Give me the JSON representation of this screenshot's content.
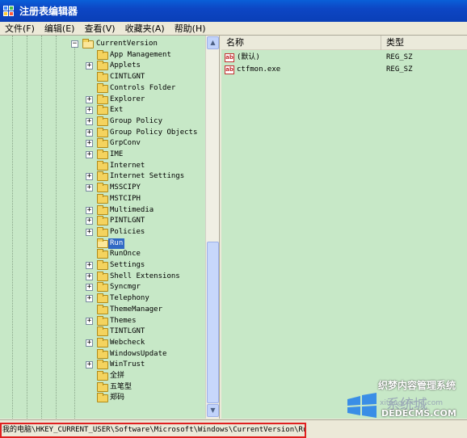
{
  "window": {
    "title": "注册表编辑器"
  },
  "menu": [
    {
      "label": "文件(F)"
    },
    {
      "label": "编辑(E)"
    },
    {
      "label": "查看(V)"
    },
    {
      "label": "收藏夹(A)"
    },
    {
      "label": "帮助(H)"
    }
  ],
  "tree": {
    "parent": {
      "label": "CurrentVersion",
      "expander": "−"
    },
    "items": [
      {
        "label": "App Management",
        "expandable": false
      },
      {
        "label": "Applets",
        "expandable": true
      },
      {
        "label": "CINTLGNT",
        "expandable": false
      },
      {
        "label": "Controls Folder",
        "expandable": false
      },
      {
        "label": "Explorer",
        "expandable": true
      },
      {
        "label": "Ext",
        "expandable": true
      },
      {
        "label": "Group Policy",
        "expandable": true
      },
      {
        "label": "Group Policy Objects",
        "expandable": true
      },
      {
        "label": "GrpConv",
        "expandable": true
      },
      {
        "label": "IME",
        "expandable": true
      },
      {
        "label": "Internet",
        "expandable": false
      },
      {
        "label": "Internet Settings",
        "expandable": true
      },
      {
        "label": "MSSCIPY",
        "expandable": true
      },
      {
        "label": "MSTCIPH",
        "expandable": false
      },
      {
        "label": "Multimedia",
        "expandable": true
      },
      {
        "label": "PINTLGNT",
        "expandable": true
      },
      {
        "label": "Policies",
        "expandable": true
      },
      {
        "label": "Run",
        "expandable": false,
        "selected": true
      },
      {
        "label": "RunOnce",
        "expandable": false
      },
      {
        "label": "Settings",
        "expandable": true
      },
      {
        "label": "Shell Extensions",
        "expandable": true
      },
      {
        "label": "Syncmgr",
        "expandable": true
      },
      {
        "label": "Telephony",
        "expandable": true
      },
      {
        "label": "ThemeManager",
        "expandable": false
      },
      {
        "label": "Themes",
        "expandable": true
      },
      {
        "label": "TINTLGNT",
        "expandable": false
      },
      {
        "label": "Webcheck",
        "expandable": true
      },
      {
        "label": "WindowsUpdate",
        "expandable": false
      },
      {
        "label": "WinTrust",
        "expandable": true
      },
      {
        "label": "全拼",
        "expandable": false
      },
      {
        "label": "五笔型",
        "expandable": false
      },
      {
        "label": "郑码",
        "expandable": false
      }
    ]
  },
  "list": {
    "columns": {
      "name": "名称",
      "type": "类型"
    },
    "rows": [
      {
        "name": "(默认)",
        "type": "REG_SZ",
        "icon": "ab"
      },
      {
        "name": "ctfmon.exe",
        "type": "REG_SZ",
        "icon": "ab"
      }
    ]
  },
  "status": {
    "path": "我的电脑\\HKEY_CURRENT_USER\\Software\\Microsoft\\Windows\\CurrentVersion\\Run"
  },
  "watermark": {
    "top": "织梦内容管理系统",
    "mid": "系统城",
    "url": "xitongcheng.com",
    "domain": "DEDECMS.COM"
  },
  "colors": {
    "pane_bg": "#c7e8c7",
    "selection": "#316ac5",
    "status_highlight": "#e02020",
    "titlebar": "#0a4fcb"
  }
}
